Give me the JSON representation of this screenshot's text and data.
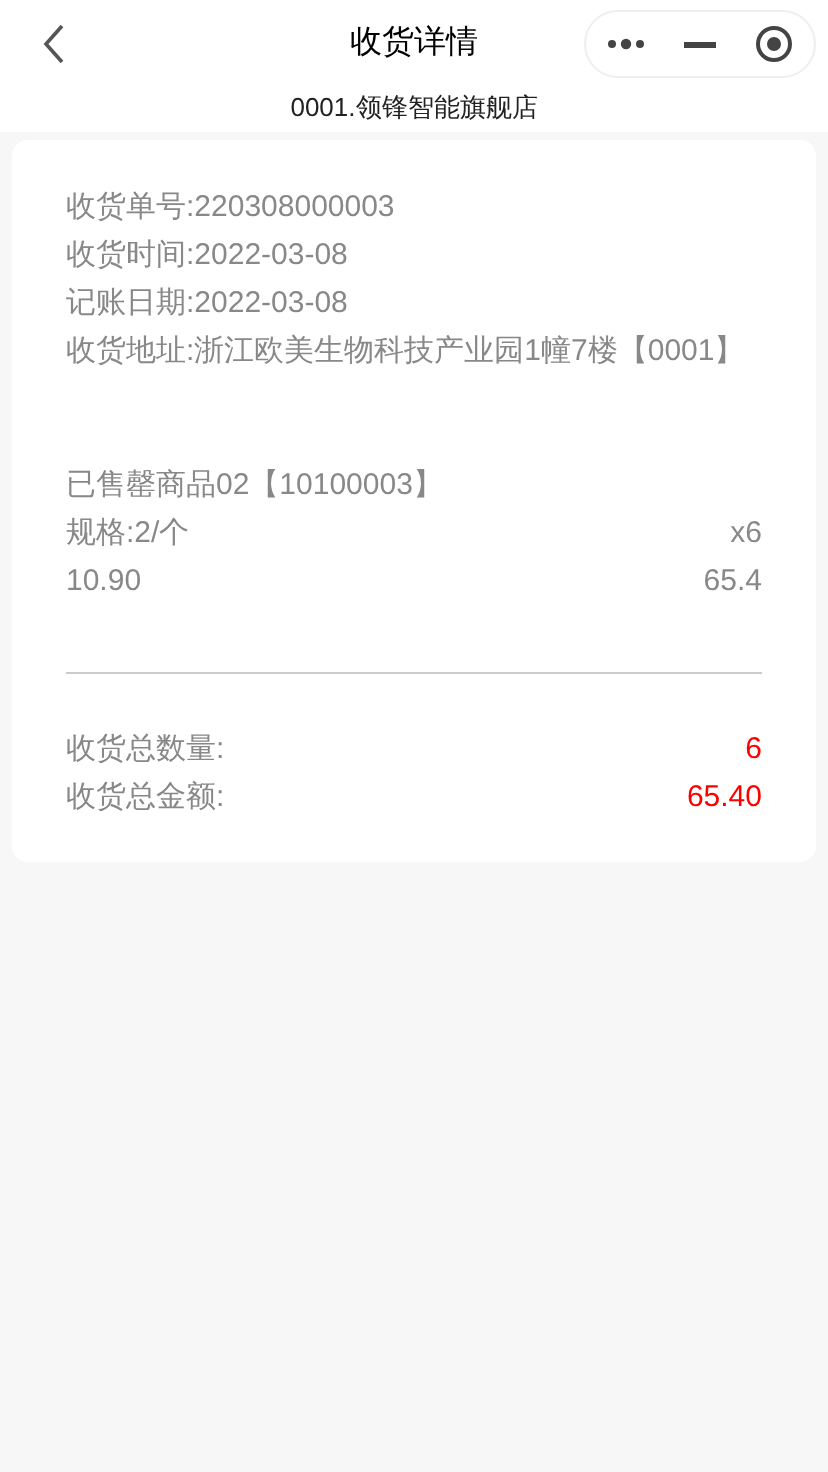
{
  "nav": {
    "title": "收货详情",
    "subtitle": "0001.领锋智能旗舰店"
  },
  "info": [
    "收货单号:220308000003",
    "收货时间:2022-03-08",
    "记账日期:2022-03-08",
    "收货地址:浙江欧美生物科技产业园1幢7楼【0001】"
  ],
  "items": [
    {
      "name": "已售罄商品02【10100003】",
      "spec": "规格:2/个",
      "qty": "x6",
      "price": "10.90",
      "amount": "65.4"
    }
  ],
  "totals": [
    {
      "label": "收货总数量:",
      "value": "6"
    },
    {
      "label": "收货总金额:",
      "value": "65.40"
    }
  ]
}
